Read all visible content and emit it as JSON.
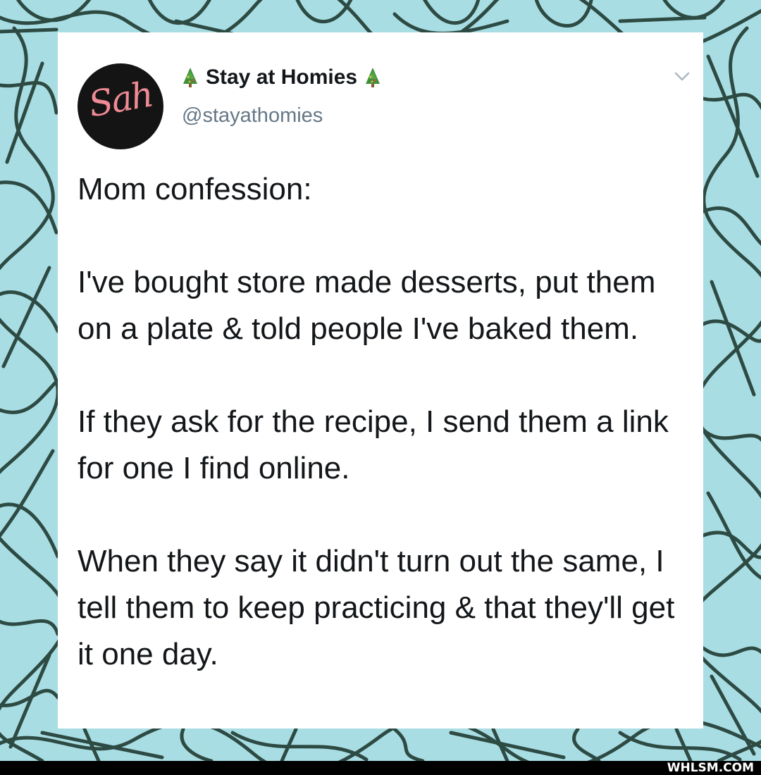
{
  "colors": {
    "background": "#a8dde3",
    "scribble": "#2d4a43",
    "card": "#ffffff",
    "avatar_bg": "#141414",
    "avatar_text": "#f08a94",
    "name": "#14171a",
    "handle": "#657786",
    "chevron": "#aab8c2",
    "footer": "#000000"
  },
  "tweet_header": {
    "avatar_text": "Sah",
    "display_name": "Stay at Homies",
    "name_icons": [
      "christmas-tree-icon",
      "christmas-tree-icon"
    ],
    "handle": "@stayathomies",
    "menu_icon": "chevron-down-icon"
  },
  "tweet_body": {
    "paragraphs": [
      "Mom confession:",
      "I've bought store made desserts, put them on a plate & told people I've baked them.",
      "If they ask for the recipe, I send them a link for one I find online.",
      "When they say it didn't turn out the same, I tell them to keep practicing & that they'll get it one day."
    ]
  },
  "footer": {
    "watermark": "WHLSM.COM"
  }
}
